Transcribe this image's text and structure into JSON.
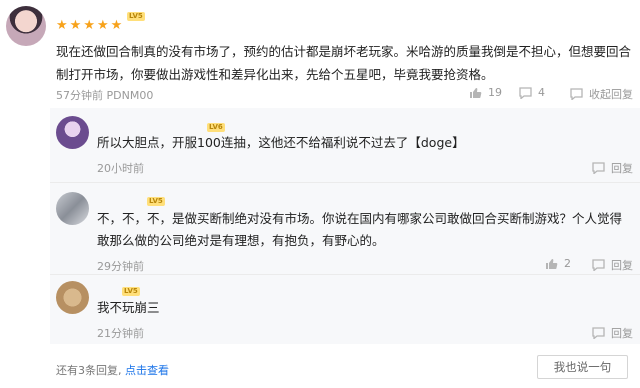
{
  "main_comment": {
    "level_badge": "LV5",
    "text": "现在还做回合制真的没有市场了，预约的估计都是崩坏老玩家。米哈游的质量我倒是不担心，但想要回合制打开市场，你要做出游戏性和差异化出来，先给个五星吧，毕竟我要抢资格。",
    "timestamp": "57分钟前",
    "device": "PDNM00",
    "likes": "19",
    "comments": "4",
    "collapse_label": "收起回复"
  },
  "replies": [
    {
      "level_badge": "LV6",
      "text": "所以大胆点，开服100连抽，这他还不给福利说不过去了【doge】",
      "timestamp": "20小时前",
      "reply_label": "回复"
    },
    {
      "level_badge": "LV5",
      "text": "不，不，不，是做买断制绝对没有市场。你说在国内有哪家公司敢做回合买断制游戏？个人觉得敢那么做的公司绝对是有理想，有抱负，有野心的。",
      "timestamp": "29分钟前",
      "likes": "2",
      "reply_label": "回复"
    },
    {
      "level_badge": "LV5",
      "text": "我不玩崩三",
      "timestamp": "21分钟前",
      "reply_label": "回复"
    }
  ],
  "footer": {
    "more_replies_prefix": "还有3条回复,",
    "more_replies_link": "点击查看",
    "reply_box_label": "我也说一句"
  },
  "colors": {
    "star": "#f7a21b",
    "link": "#1a73e8",
    "muted": "#999999"
  }
}
